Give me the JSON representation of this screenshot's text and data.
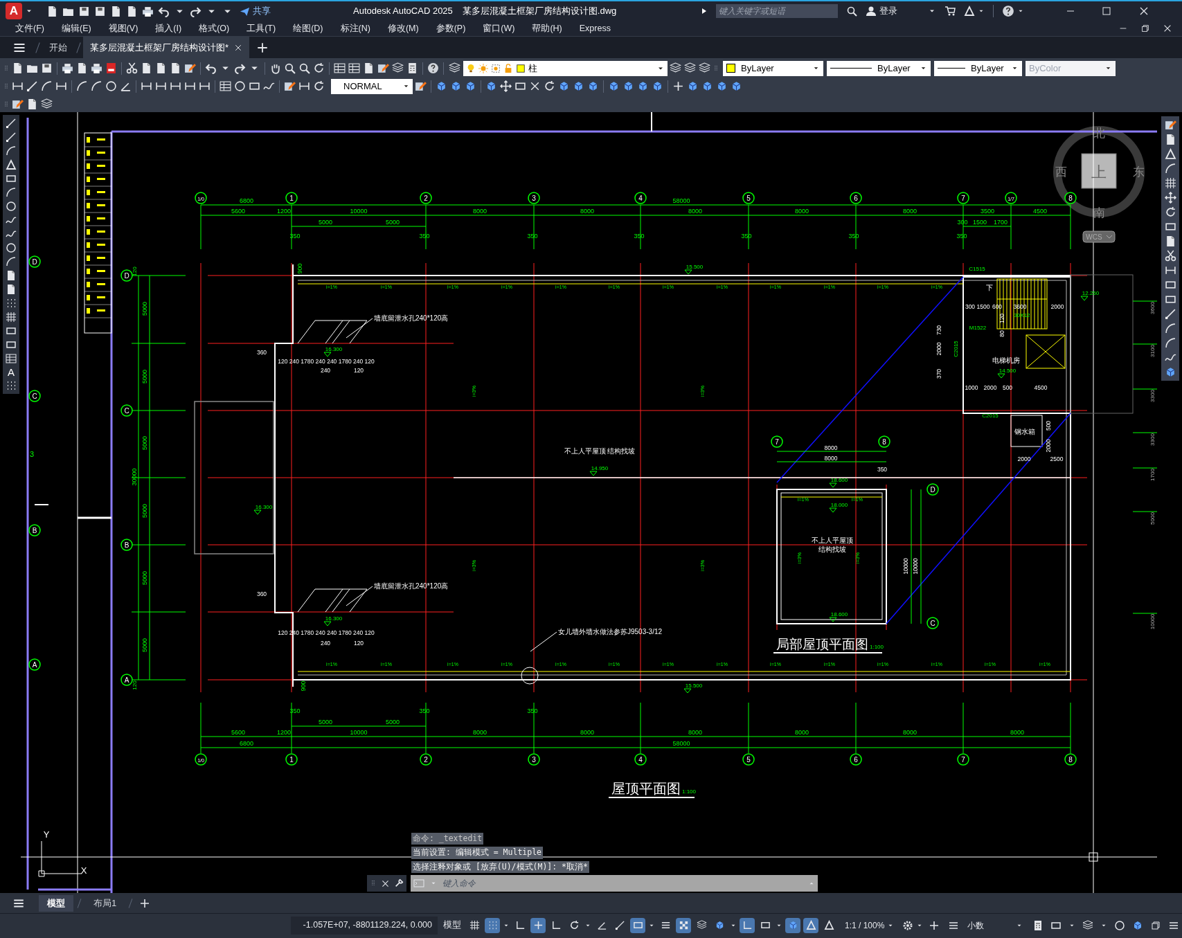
{
  "app_logo": "A",
  "share_button": "共享",
  "title": {
    "app": "Autodesk AutoCAD 2025",
    "file": "某多层混凝土框架厂房结构设计图.dwg"
  },
  "search": {
    "placeholder": "键入关键字或短语"
  },
  "sign_in": "登录",
  "menu": [
    "文件(F)",
    "编辑(E)",
    "视图(V)",
    "插入(I)",
    "格式(O)",
    "工具(T)",
    "绘图(D)",
    "标注(N)",
    "修改(M)",
    "参数(P)",
    "窗口(W)",
    "帮助(H)",
    "Express"
  ],
  "doc_tabs": [
    {
      "label": "开始",
      "selected": false
    },
    {
      "label": "某多层混凝土框架厂房结构设计图*",
      "selected": true
    }
  ],
  "layer_combo": {
    "value": "柱"
  },
  "property_combos": [
    {
      "value": "ByLayer",
      "kind": "color",
      "disabled": false
    },
    {
      "value": "ByLayer",
      "kind": "linetype",
      "disabled": false
    },
    {
      "value": "ByLayer",
      "kind": "lineweight",
      "disabled": false
    },
    {
      "value": "ByColor",
      "kind": "plotstyle",
      "disabled": true
    }
  ],
  "dimstyle_combo": {
    "value": "NORMAL"
  },
  "draw_toolbar": {
    "text_tool": "A"
  },
  "drawing": {
    "top_axis_labels": [
      "1/0",
      "1",
      "2",
      "3",
      "4",
      "5",
      "6",
      "7",
      "1/7",
      "8"
    ],
    "top_dims_overall": [
      "6800",
      "58000"
    ],
    "top_dims_axes": [
      "5600",
      "1200",
      "10000",
      "8000",
      "8000",
      "8000",
      "8000",
      "8000",
      "3500",
      "4500"
    ],
    "top_dims_detail": [
      "5000",
      "5000",
      "300",
      "1500",
      "1700"
    ],
    "top_column_dims": [
      "350",
      "350",
      "350",
      "350",
      "350",
      "350",
      "350"
    ],
    "left_axis_labels": [
      "D",
      "C",
      "B",
      "A"
    ],
    "left_dims": [
      "5000",
      "5000",
      "5000",
      "5000",
      "5000",
      "5000"
    ],
    "left_overall": "30000",
    "left_end_dims": [
      "120",
      "120"
    ],
    "bottom_column_dims": [
      "350",
      "350",
      "350"
    ],
    "bottom_dims_detail": [
      "5000",
      "5000"
    ],
    "bottom_dims_axes": [
      "5600",
      "1200",
      "10000",
      "8000",
      "8000",
      "8000",
      "8000",
      "8000",
      "8000"
    ],
    "bottom_dims_overall": [
      "6800",
      "58000"
    ],
    "bottom_axis_labels": [
      "1/0",
      "1",
      "2",
      "3",
      "4",
      "5",
      "6",
      "7",
      "8"
    ],
    "local_axis_labels": [
      "7",
      "8",
      "D",
      "C"
    ],
    "edge_axis_labels": [
      "D",
      "C",
      "B",
      "A"
    ],
    "edge_marker": "3",
    "annotations": [
      {
        "text": "900",
        "kind": "dim"
      },
      {
        "text": "15.500",
        "kind": "level"
      },
      {
        "text": "i=1%",
        "kind": "slope"
      },
      {
        "text": "i=1%",
        "kind": "slope"
      },
      {
        "text": "i=1%",
        "kind": "slope"
      },
      {
        "text": "i=1%",
        "kind": "slope"
      },
      {
        "text": "i=1%",
        "kind": "slope"
      },
      {
        "text": "i=1%",
        "kind": "slope"
      },
      {
        "text": "i=1%",
        "kind": "slope"
      },
      {
        "text": "i=1%",
        "kind": "slope"
      },
      {
        "text": "i=1%",
        "kind": "slope"
      },
      {
        "text": "i=1%",
        "kind": "slope"
      },
      {
        "text": "i=1%",
        "kind": "slope"
      },
      {
        "text": "i=1%",
        "kind": "slope"
      },
      {
        "text": "墙底留泄水孔240*120高",
        "kind": "note"
      },
      {
        "text": "16.300",
        "kind": "level"
      },
      {
        "text": "360",
        "kind": "label"
      },
      {
        "text": "120 240 1780 240 240 1780 240 120",
        "kind": "label"
      },
      {
        "text": "240",
        "kind": "label"
      },
      {
        "text": "120",
        "kind": "label"
      },
      {
        "text": "i=3%",
        "kind": "slope"
      },
      {
        "text": "i=3%",
        "kind": "slope"
      },
      {
        "text": "不上人平屋顶",
        "kind": "room"
      },
      {
        "text": "结构找坡",
        "kind": "room"
      },
      {
        "text": "14.950",
        "kind": "level"
      },
      {
        "text": "16.300",
        "kind": "level"
      },
      {
        "text": "i=3%",
        "kind": "slope"
      },
      {
        "text": "i=3%",
        "kind": "slope"
      },
      {
        "text": "墙底留泄水孔240*120高",
        "kind": "note"
      },
      {
        "text": "360",
        "kind": "label"
      },
      {
        "text": "16.300",
        "kind": "level"
      },
      {
        "text": "120 240 1780 240 240 1780 240 120",
        "kind": "label"
      },
      {
        "text": "240",
        "kind": "label"
      },
      {
        "text": "120",
        "kind": "label"
      },
      {
        "text": "女儿墙外墙水做法参苏J9503-3/12",
        "kind": "note"
      },
      {
        "text": "i=1%",
        "kind": "slope"
      },
      {
        "text": "i=1%",
        "kind": "slope"
      },
      {
        "text": "i=1%",
        "kind": "slope"
      },
      {
        "text": "i=1%",
        "kind": "slope"
      },
      {
        "text": "i=1%",
        "kind": "slope"
      },
      {
        "text": "i=1%",
        "kind": "slope"
      },
      {
        "text": "i=1%",
        "kind": "slope"
      },
      {
        "text": "i=1%",
        "kind": "slope"
      },
      {
        "text": "i=1%",
        "kind": "slope"
      },
      {
        "text": "i=1%",
        "kind": "slope"
      },
      {
        "text": "i=1%",
        "kind": "slope"
      },
      {
        "text": "i=1%",
        "kind": "slope"
      },
      {
        "text": "i=1%",
        "kind": "slope"
      },
      {
        "text": "i=1%",
        "kind": "slope"
      },
      {
        "text": "900",
        "kind": "dim"
      },
      {
        "text": "15.500",
        "kind": "level"
      },
      {
        "text": "C1515",
        "kind": "code"
      },
      {
        "text": "下",
        "kind": "room"
      },
      {
        "text": "300",
        "kind": "label"
      },
      {
        "text": "1500",
        "kind": "label"
      },
      {
        "text": "600",
        "kind": "label"
      },
      {
        "text": "3600",
        "kind": "label"
      },
      {
        "text": "2000",
        "kind": "label"
      },
      {
        "text": "120",
        "kind": "label"
      },
      {
        "text": "30X12",
        "kind": "code"
      },
      {
        "text": "M1522",
        "kind": "code"
      },
      {
        "text": "80",
        "kind": "label"
      },
      {
        "text": "730",
        "kind": "label"
      },
      {
        "text": "2000",
        "kind": "label"
      },
      {
        "text": "370",
        "kind": "label"
      },
      {
        "text": "C2015",
        "kind": "code"
      },
      {
        "text": "电梯机房",
        "kind": "room"
      },
      {
        "text": "14.500",
        "kind": "level"
      },
      {
        "text": "1000",
        "kind": "label"
      },
      {
        "text": "2000",
        "kind": "label"
      },
      {
        "text": "500",
        "kind": "label"
      },
      {
        "text": "4500",
        "kind": "label"
      },
      {
        "text": "C2015",
        "kind": "code"
      },
      {
        "text": "500",
        "kind": "label"
      },
      {
        "text": "钢水箱",
        "kind": "room"
      },
      {
        "text": "2000",
        "kind": "label"
      },
      {
        "text": "2000",
        "kind": "label"
      },
      {
        "text": "2500",
        "kind": "label"
      },
      {
        "text": "12.250",
        "kind": "level"
      },
      {
        "text": "8000",
        "kind": "label"
      },
      {
        "text": "8000",
        "kind": "label"
      },
      {
        "text": "350",
        "kind": "label"
      },
      {
        "text": "18.600",
        "kind": "level"
      },
      {
        "text": "i=1%",
        "kind": "slope"
      },
      {
        "text": "i=1%",
        "kind": "slope"
      },
      {
        "text": "18.000",
        "kind": "level"
      },
      {
        "text": "不上人平屋顶",
        "kind": "room"
      },
      {
        "text": "结构找坡",
        "kind": "room"
      },
      {
        "text": "i=3%",
        "kind": "slope"
      },
      {
        "text": "i=3%",
        "kind": "slope"
      },
      {
        "text": "10000",
        "kind": "label"
      },
      {
        "text": "10000",
        "kind": "label"
      },
      {
        "text": "18.600",
        "kind": "level"
      },
      {
        "text": "3600",
        "kind": "edge"
      },
      {
        "text": "3100",
        "kind": "edge"
      },
      {
        "text": "3300",
        "kind": "edge"
      },
      {
        "text": "3300",
        "kind": "edge"
      },
      {
        "text": "1700",
        "kind": "edge"
      },
      {
        "text": "5000",
        "kind": "edge"
      },
      {
        "text": "10000",
        "kind": "edge"
      }
    ],
    "main_title": {
      "text": "屋顶平面图",
      "scale": "1:100"
    },
    "local_title": {
      "text": "局部屋顶平面图",
      "scale": "1:100"
    }
  },
  "view_cube": {
    "north": "北",
    "south": "南",
    "west": "西",
    "east": "东",
    "top": "上"
  },
  "wcs_button": "WCS",
  "ucs_icon": {
    "y": "Y",
    "x": "X"
  },
  "command_history": [
    "命令: _textedit",
    "当前设置: 编辑模式 = Multiple",
    "选择注释对象或 [放弃(U)/模式(M)]: *取消*"
  ],
  "command_input": {
    "placeholder": "键入命令"
  },
  "layout_tabs": [
    {
      "label": "模型",
      "selected": true
    },
    {
      "label": "布局1",
      "selected": false
    }
  ],
  "status_bar": {
    "coordinates": "-1.057E+07, -8801129.224, 0.000",
    "space": "模型",
    "toggles": [
      {
        "on": false
      },
      {
        "on": true
      },
      {
        "on": false
      },
      {
        "on": true
      },
      {
        "on": false
      },
      {
        "on": false
      },
      {
        "on": false
      },
      {
        "on": false
      },
      {
        "on": true
      },
      {
        "on": false
      },
      {
        "on": true
      },
      {
        "on": false
      },
      {
        "on": false
      },
      {
        "on": true
      },
      {
        "on": false
      },
      {
        "on": true
      },
      {
        "on": true
      },
      {
        "on": false
      }
    ],
    "annotation_scale": "1:1 / 100%",
    "units": "小数"
  }
}
